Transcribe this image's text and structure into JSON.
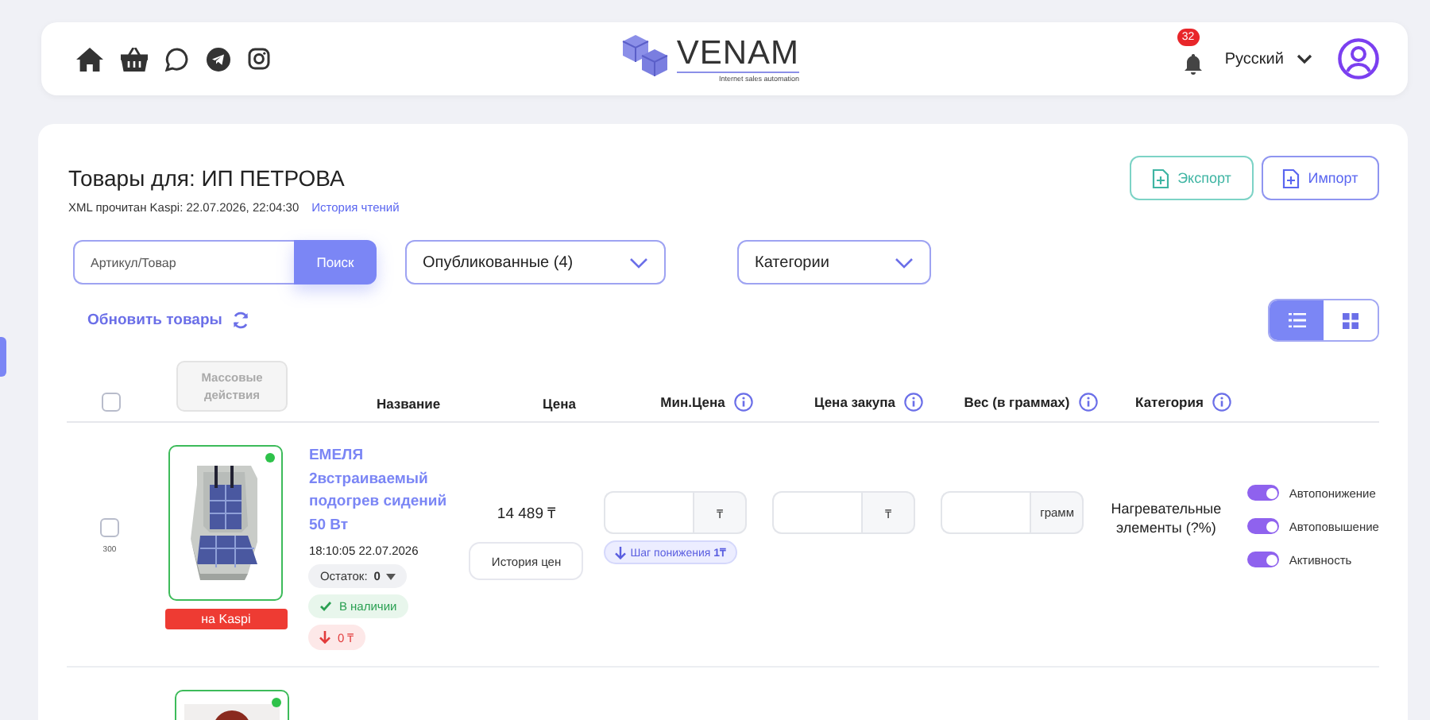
{
  "header": {
    "logo_text": "VENAM",
    "logo_tagline": "Internet sales automation",
    "notifications": "32",
    "language": "Русский"
  },
  "page": {
    "title": "Товары для: ИП ПЕТРОВА",
    "xml_status": "XML прочитан Kaspi: 22.07.2026, 22:04:30",
    "history_link": "История чтений",
    "buttons": [
      {
        "label": "Экспорт",
        "kind": "export"
      },
      {
        "label": "Импорт",
        "kind": "import"
      }
    ]
  },
  "filters": {
    "search": {
      "placeholder": "Артикул/Товар",
      "button": "Поиск"
    },
    "status": "Опубликованные (4)",
    "category": "Категории",
    "refresh": "Обновить товары",
    "views": [
      {
        "kind": "list",
        "selected": true
      },
      {
        "kind": "grid",
        "selected": false
      }
    ]
  },
  "table": {
    "select_all": {
      "checked": false
    },
    "bulk_button": "Массовые действия",
    "columns": [
      {
        "label": "Название"
      },
      {
        "label": "Цена"
      },
      {
        "label": "Мин.Цена",
        "info": true
      },
      {
        "label": "Цена закупа",
        "info": true
      },
      {
        "label": "Вес (в граммах)",
        "info": true
      },
      {
        "label": "Категория",
        "info": true
      }
    ],
    "rows": [
      {
        "checked": false,
        "id": "300",
        "online": true,
        "kaspi": "на Kaspi",
        "name": "ЕМЕЛЯ 2встраиваемый подогрев сидений 50 Вт",
        "time": "18:10:05 22.07.2026",
        "stock": "Остаток:",
        "stock_value": "0",
        "availability": "В наличии",
        "change": "0 ₸",
        "price": "14 489 ₸",
        "history": "История цен",
        "currency": "₸",
        "step": "Шаг понижения",
        "step_value": "1₸",
        "purchase_currency": "₸",
        "weight_unit": "грамм",
        "category": "Нагревательные элементы (?%)",
        "toggles": [
          {
            "label": "Автопонижение",
            "on": true
          },
          {
            "label": "Автоповышение",
            "on": true
          },
          {
            "label": "Активность",
            "on": true
          }
        ]
      },
      {
        "online": true
      }
    ]
  }
}
